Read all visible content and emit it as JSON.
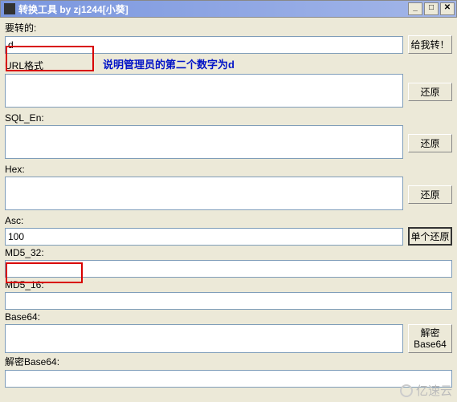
{
  "window": {
    "title": "转换工具 by zj1244[小葵]"
  },
  "annotation": "说明管理员的第二个数字为d",
  "fields": {
    "input": {
      "label": "要转的:",
      "value": "d",
      "button": "给我转！"
    },
    "url": {
      "label": "URL格式",
      "value": "",
      "button": "还原"
    },
    "sqlen": {
      "label": "SQL_En:",
      "value": "",
      "button": "还原"
    },
    "hex": {
      "label": "Hex:",
      "value": "",
      "button": "还原"
    },
    "asc": {
      "label": "Asc:",
      "value": "100",
      "button": "单个还原"
    },
    "md532": {
      "label": "MD5_32:",
      "value": ""
    },
    "md516": {
      "label": "MD5_16:",
      "value": ""
    },
    "base64": {
      "label": "Base64:",
      "value": "",
      "button": "解密\nBase64"
    },
    "decb64": {
      "label": "解密Base64:",
      "value": ""
    }
  },
  "watermark": "亿速云"
}
